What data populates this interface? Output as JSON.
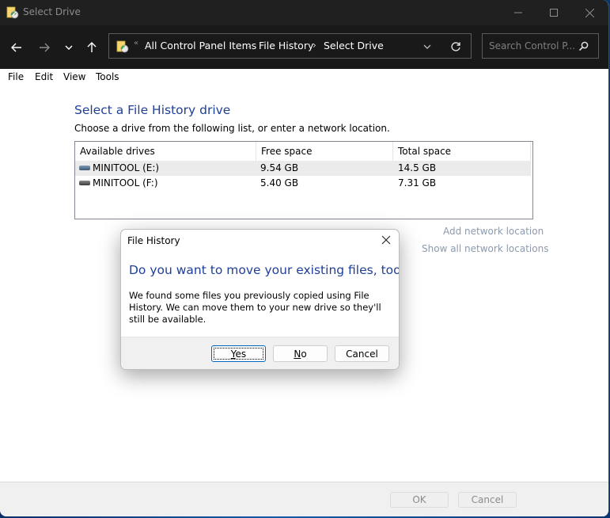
{
  "window": {
    "title": "Select Drive",
    "controls": {
      "minimize": "minimize-icon",
      "maximize": "maximize-icon",
      "close": "close-icon"
    }
  },
  "nav": {
    "back": "arrow-left-icon",
    "forward": "arrow-right-icon",
    "recent": "chevron-down-icon",
    "up": "arrow-up-icon",
    "breadcrumb": [
      "All Control Panel Items",
      "File History",
      "Select Drive"
    ],
    "overflow_glyph": "«",
    "separator": "›",
    "refresh": "refresh-icon",
    "search_placeholder": "Search Control P...",
    "search_icon": "search-icon"
  },
  "menu": [
    "File",
    "Edit",
    "View",
    "Tools"
  ],
  "main": {
    "heading": "Select a File History drive",
    "subtext": "Choose a drive from the following list, or enter a network location.",
    "columns": [
      "Available drives",
      "Free space",
      "Total space"
    ],
    "drives": [
      {
        "name": "MINITOOL (E:)",
        "free": "9.54 GB",
        "total": "14.5 GB",
        "selected": true
      },
      {
        "name": "MINITOOL (F:)",
        "free": "5.40 GB",
        "total": "7.31 GB",
        "selected": false
      }
    ],
    "links": [
      "Add network location",
      "Show all network locations"
    ]
  },
  "footer": {
    "ok": "OK",
    "cancel": "Cancel"
  },
  "dialog": {
    "title": "File History",
    "heading": "Do you want to move your existing files, too?",
    "body": "We found some files you previously copied using File History. We can move them to your new drive so they'll still be available.",
    "yes_prefix": "Y",
    "yes_rest": "es",
    "no_prefix": "N",
    "no_rest": "o",
    "cancel": "Cancel"
  },
  "colors": {
    "heading_blue": "#1e3f9a",
    "titlebar": "#202020",
    "navbar": "#191919",
    "link_gray": "#8c9aac",
    "default_button_border": "#0067c0"
  }
}
